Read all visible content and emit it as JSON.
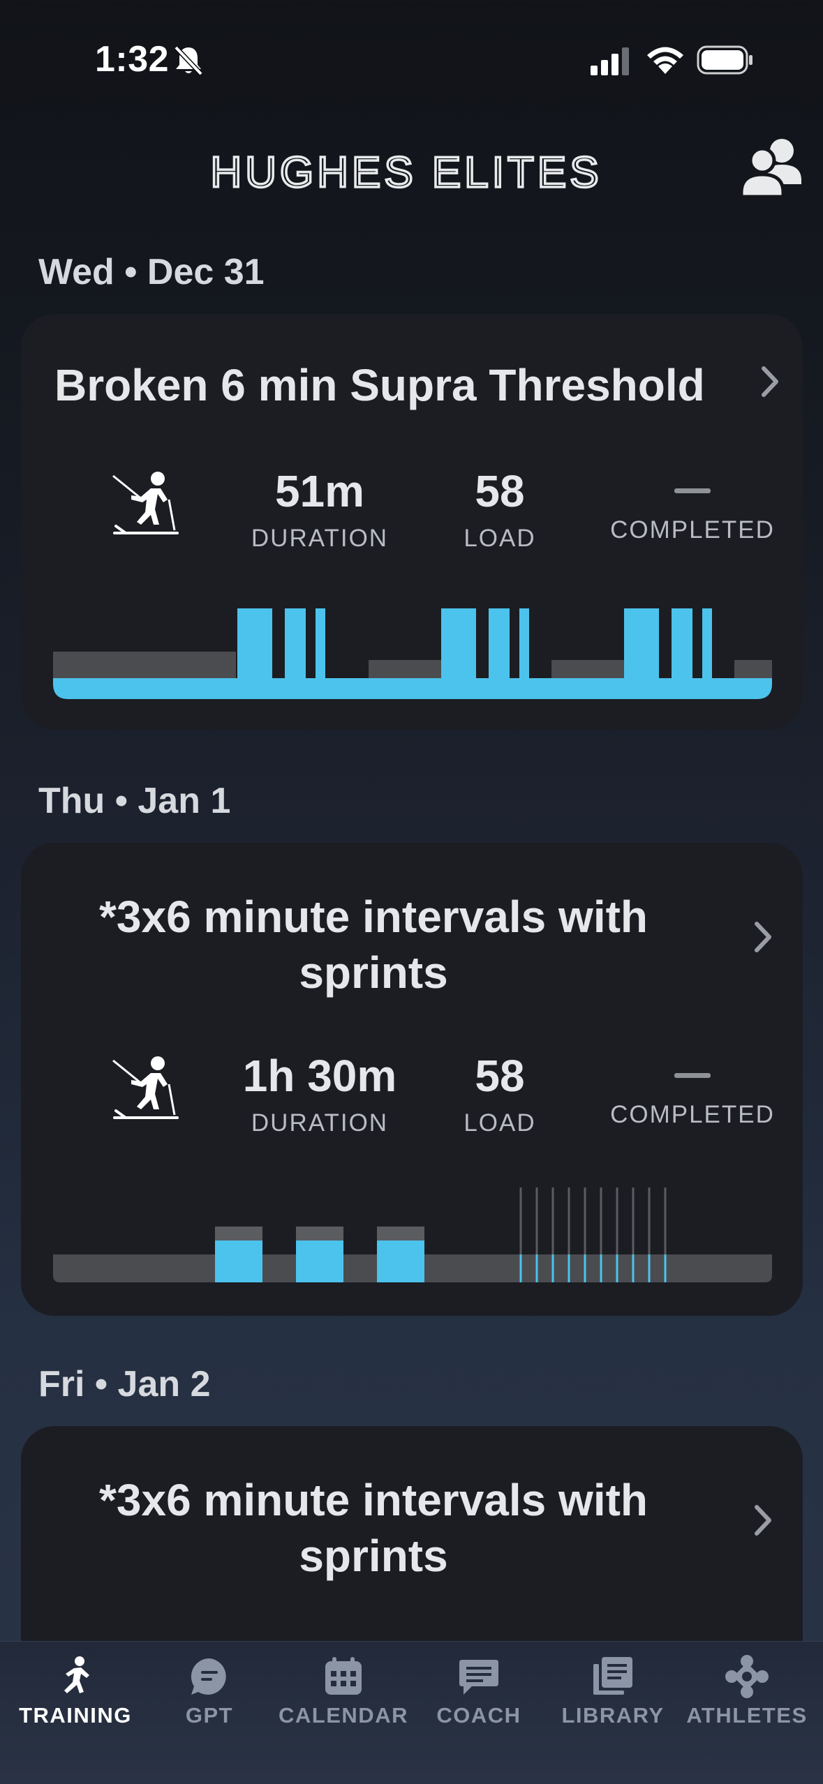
{
  "status_bar": {
    "time": "1:32"
  },
  "header": {
    "brand": "HUGHES ELITES",
    "people_icon": "people-icon"
  },
  "days": [
    {
      "heading": "Wed • Dec 31",
      "workout": {
        "title": "Broken 6 min Supra Threshold",
        "sport_icon": "skiing-icon",
        "duration_value": "51m",
        "duration_label": "DURATION",
        "load_value": "58",
        "load_label": "LOAD",
        "completed_value": "—",
        "completed_label": "COMPLETED"
      }
    },
    {
      "heading": "Thu • Jan 1",
      "workout": {
        "title": "*3x6 minute intervals with sprints",
        "sport_icon": "skiing-icon",
        "duration_value": "1h 30m",
        "duration_label": "DURATION",
        "load_value": "58",
        "load_label": "LOAD",
        "completed_value": "—",
        "completed_label": "COMPLETED"
      }
    },
    {
      "heading": "Fri • Jan 2",
      "workout": {
        "title": "*3x6 minute intervals with sprints"
      }
    }
  ],
  "tabs": [
    {
      "label": "TRAINING",
      "icon": "running-icon",
      "active": true
    },
    {
      "label": "GPT",
      "icon": "chat-bubble-icon",
      "active": false
    },
    {
      "label": "CALENDAR",
      "icon": "calendar-icon",
      "active": false
    },
    {
      "label": "COACH",
      "icon": "message-icon",
      "active": false
    },
    {
      "label": "LIBRARY",
      "icon": "library-icon",
      "active": false
    },
    {
      "label": "ATHLETES",
      "icon": "athletes-icon",
      "active": false
    }
  ],
  "colors": {
    "accent": "#4cc3ec",
    "card": "#1b1d23",
    "inactive_tab": "#8c95a6"
  }
}
